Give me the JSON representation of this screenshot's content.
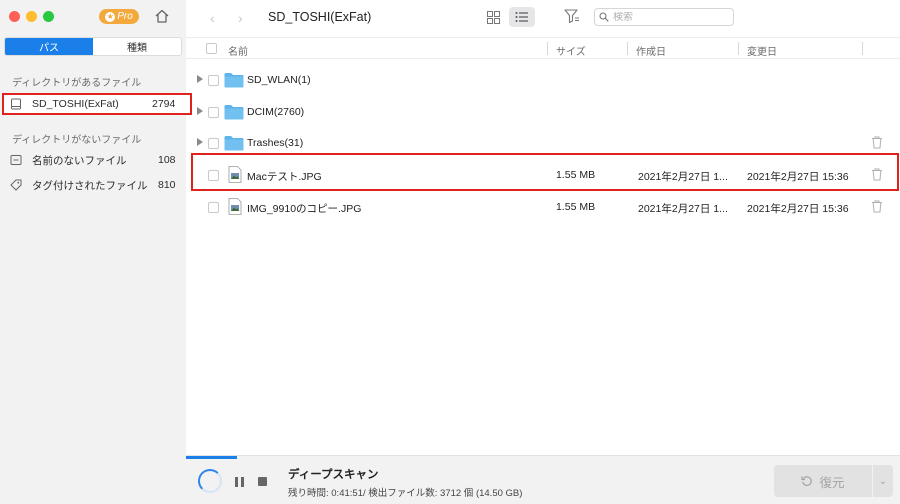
{
  "sidebar": {
    "pro_label": "Pro",
    "tabs": [
      {
        "label": "パス",
        "active": true
      },
      {
        "label": "種類",
        "active": false
      }
    ],
    "section_with_dir": "ディレクトリがあるファイル",
    "drive": {
      "label": "SD_TOSHI(ExFat)",
      "count": "2794"
    },
    "section_without_dir": "ディレクトリがないファイル",
    "items": [
      {
        "label": "名前のないファイル",
        "count": "108",
        "icon": "folder-minus-icon"
      },
      {
        "label": "タグ付けされたファイル",
        "count": "810",
        "icon": "tag-icon"
      }
    ]
  },
  "topbar": {
    "path_title": "SD_TOSHI(ExFat)",
    "search_placeholder": "検索"
  },
  "columns": {
    "name": "名前",
    "size": "サイズ",
    "created": "作成日",
    "modified": "変更日"
  },
  "rows": [
    {
      "type": "folder",
      "name": "SD_WLAN(1)",
      "size": "",
      "created": "",
      "modified": ""
    },
    {
      "type": "folder",
      "name": "DCIM(2760)",
      "size": "",
      "created": "",
      "modified": ""
    },
    {
      "type": "folder",
      "name": "Trashes(31)",
      "size": "",
      "created": "",
      "modified": ""
    },
    {
      "type": "file",
      "name": "Macテスト.JPG",
      "size": "1.55 MB",
      "created": "2021年2月27日 1...",
      "modified": "2021年2月27日 15:36"
    },
    {
      "type": "file",
      "name": "IMG_9910のコピー.JPG",
      "size": "1.55 MB",
      "created": "2021年2月27日 1...",
      "modified": "2021年2月27日 15:36"
    }
  ],
  "bottombar": {
    "scan_title": "ディープスキャン",
    "scan_info": "残り時間: 0:41:51/ 検出ファイル数: 3712 個 (14.50 GB)",
    "restore_label": "復元"
  },
  "colors": {
    "accent": "#1a7fe8",
    "highlight": "#e0221c",
    "folder": "#5eb3e8"
  }
}
